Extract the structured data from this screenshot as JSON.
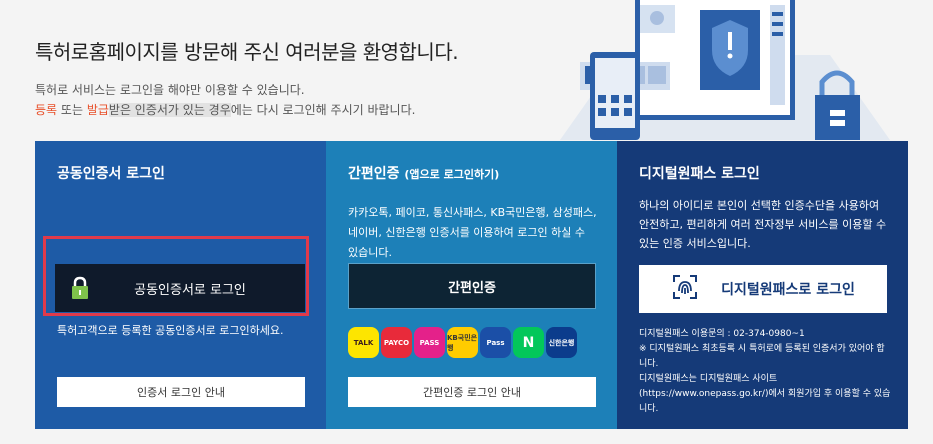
{
  "welcome": {
    "title": "특허로홈페이지를 방문해 주신 여러분을 환영합니다.",
    "line1": "특허로 서비스는 로그인을 해야만 이용할 수 있습니다.",
    "line2_register": "등록",
    "line2_or": " 또는 ",
    "line2_issue": "발급",
    "line2_received": "받은 인증서가 있는 경우",
    "line2_rest": "에는 다시 로그인해 주시기 바랍니다."
  },
  "cert_panel": {
    "title": "공동인증서 로그인",
    "button_label": "공동인증서로 로그인",
    "note": "특허고객으로 등록한 공동인증서로 로그인하세요.",
    "guide_label": "인증서 로그인 안내"
  },
  "simple_panel": {
    "title": "간편인증",
    "subtitle": "(앱으로 로그인하기)",
    "desc": "카카오톡, 페이코, 통신사패스, KB국민은행, 삼성패스, 네이버, 신한은행 인증서를 이용하여 로그인 하실 수 있습니다.",
    "button_label": "간편인증",
    "guide_label": "간편인증 로그인 안내",
    "apps": [
      "TALK",
      "PAYCO",
      "PASS",
      "KB국민은행",
      "Pass",
      "N",
      "신한은행"
    ]
  },
  "digital_panel": {
    "title": "디지털원패스 로그인",
    "desc": "하나의 아이디로 본인이 선택한 인증수단을 사용하여 안전하고, 편리하게 여러 전자정부 서비스를 이용할 수 있는 인증 서비스입니다.",
    "button_label": "디지털원패스로 로그인",
    "info1": "디지털원패스 이용문의 : 02-374-0980~1",
    "info2": "※ 디지털원패스 최초등록 시 특허로에 등록된 인증서가 있어야 합니다.",
    "info3": "디지털원패스는 디지털원패스 사이트 (https://www.onepass.go.kr/)에서 회원가입 후 이용할 수 있습니다."
  },
  "colors": {
    "cert_bg": "#1e5ba6",
    "simple_bg": "#1d80b8",
    "digital_bg": "#153a78",
    "highlight_border": "#e03a4a",
    "accent_orange": "#e8502a"
  }
}
